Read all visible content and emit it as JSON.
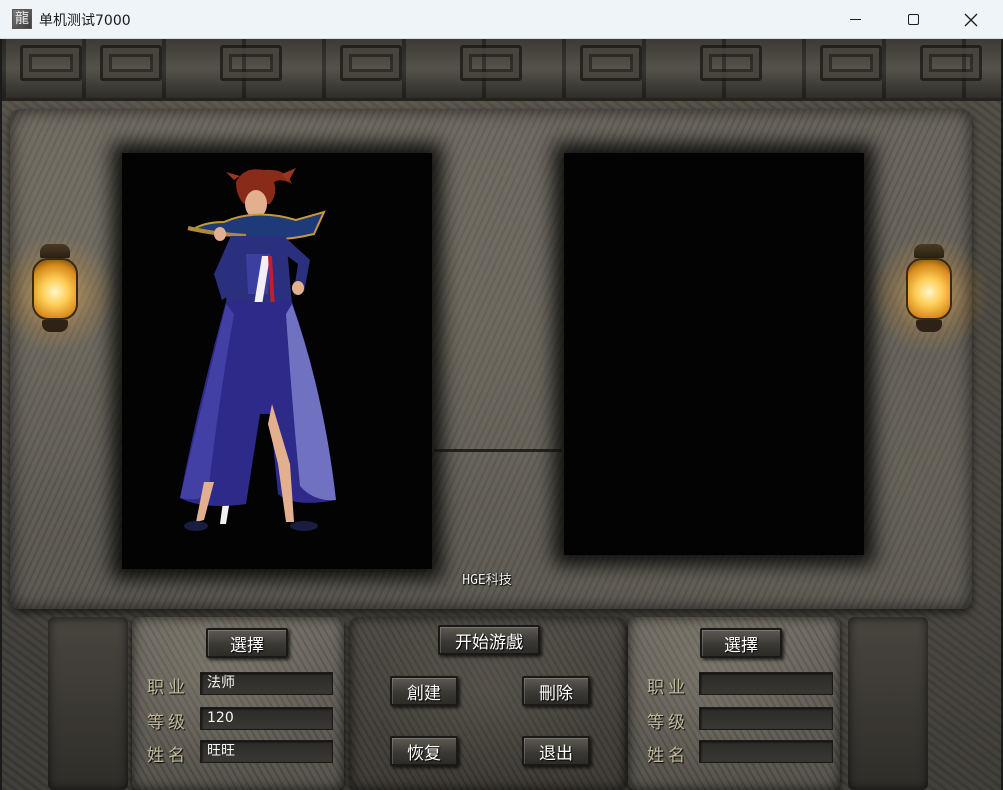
{
  "window": {
    "title": "单机测试7000",
    "icon_char": "龍"
  },
  "scene": {
    "watermark": "HGE科技"
  },
  "left_panel": {
    "select_label": "選擇",
    "job_label": "职业",
    "job_value": "法师",
    "level_label": "等级",
    "level_value": "120",
    "name_label": "姓名",
    "name_value": "旺旺"
  },
  "center_panel": {
    "start_label": "开始游戲",
    "create_label": "創建",
    "delete_label": "刪除",
    "restore_label": "恢复",
    "exit_label": "退出"
  },
  "right_panel": {
    "select_label": "選擇",
    "job_label": "职业",
    "job_value": "",
    "level_label": "等级",
    "level_value": "",
    "name_label": "姓名",
    "name_value": ""
  },
  "colors": {
    "label_gold": "#c2b89a",
    "button_text": "#ffffff",
    "lantern_glow": "#ffcc55"
  }
}
